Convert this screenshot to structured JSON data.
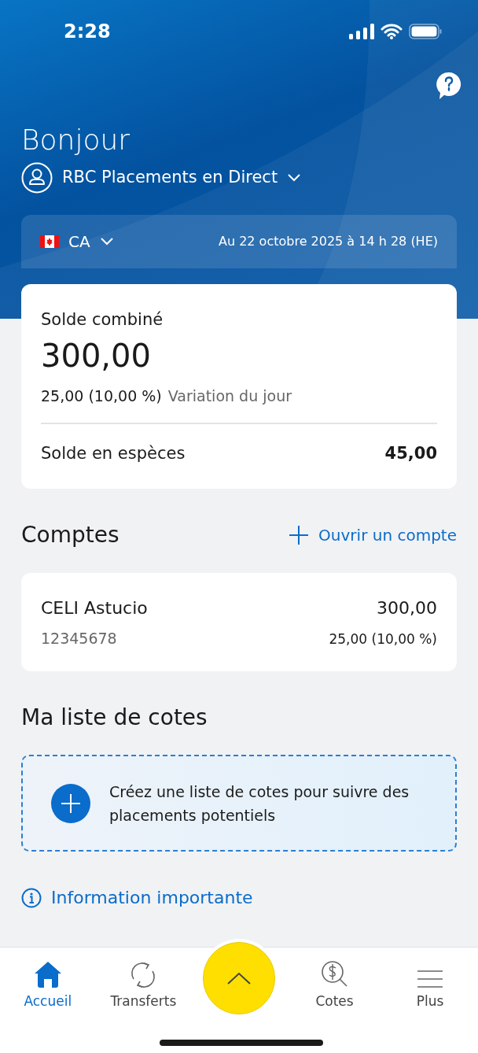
{
  "status_bar": {
    "time": "2:28"
  },
  "header": {
    "greeting": "Bonjour",
    "account_selector": "RBC Placements en Direct"
  },
  "summary": {
    "currency": "CA",
    "as_of": "Au 22 octobre 2025 à 14 h 28 (HE)",
    "title": "Solde combiné",
    "total": "300,00",
    "change": "25,00 (10,00 %)",
    "change_label": "Variation du jour",
    "cash_label": "Solde en espèces",
    "cash_value": "45,00"
  },
  "accounts": {
    "title": "Comptes",
    "open_link": "Ouvrir un compte",
    "items": [
      {
        "name": "CELI Astucio",
        "number": "12345678",
        "value": "300,00",
        "change": "25,00 (10,00 %)"
      }
    ]
  },
  "watchlist": {
    "title": "Ma liste de cotes",
    "prompt": "Créez une liste de cotes pour suivre des placements potentiels"
  },
  "info_link": "Information importante",
  "tab_bar": [
    {
      "label": "Accueil",
      "selected": true
    },
    {
      "label": "Transferts",
      "selected": false
    },
    {
      "label": "Cotes",
      "selected": false
    },
    {
      "label": "Plus",
      "selected": false
    }
  ]
}
